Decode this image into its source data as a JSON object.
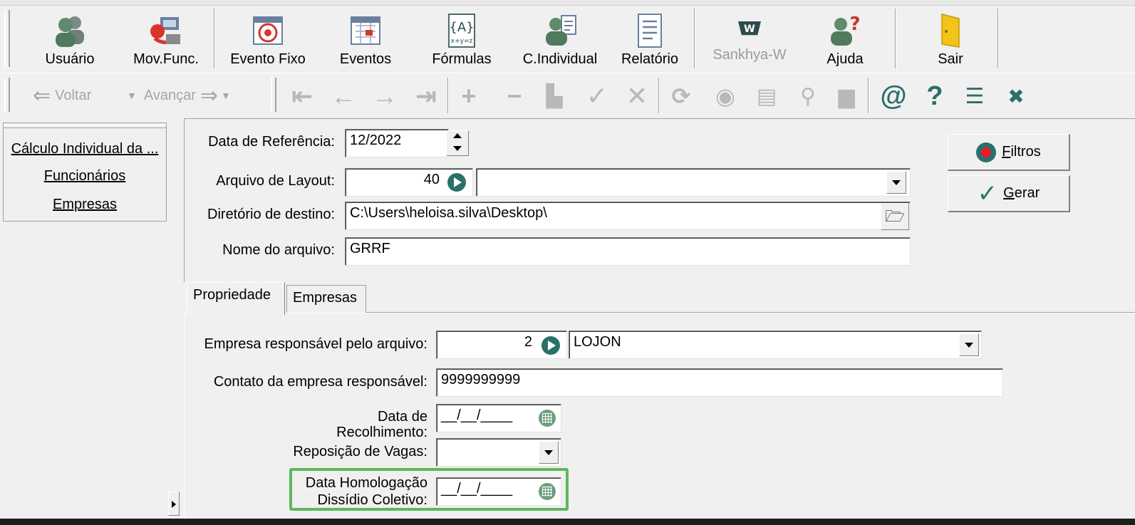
{
  "toolbar": {
    "buttons": [
      {
        "id": "usuario",
        "label": "Usuário",
        "icon": "users-icon"
      },
      {
        "id": "movfunc",
        "label": "Mov.Func.",
        "icon": "transfer-icon"
      },
      {
        "id": "eventofixo",
        "label": "Evento Fixo",
        "icon": "calendar-target-icon"
      },
      {
        "id": "eventos",
        "label": "Eventos",
        "icon": "calendar-icon"
      },
      {
        "id": "formulas",
        "label": "Fórmulas",
        "icon": "formula-icon"
      },
      {
        "id": "cindividual",
        "label": "C.Individual",
        "icon": "user-card-icon"
      },
      {
        "id": "relatorio",
        "label": "Relatório",
        "icon": "report-icon"
      },
      {
        "id": "sankhyaw",
        "label": "Sankhya-W",
        "icon": "sankhya-logo-icon"
      },
      {
        "id": "ajuda",
        "label": "Ajuda",
        "icon": "help-user-icon"
      },
      {
        "id": "sair",
        "label": "Sair",
        "icon": "exit-door-icon"
      }
    ]
  },
  "nav": {
    "voltar": "Voltar",
    "avancar": "Avançar"
  },
  "sidebar": {
    "items": [
      {
        "label": "Cálculo Individual da ..."
      },
      {
        "label": "Funcionários"
      },
      {
        "label": "Empresas"
      }
    ]
  },
  "form": {
    "data_referencia_label": "Data de Referência:",
    "data_referencia_value": "12/2022",
    "arquivo_layout_label": "Arquivo de Layout:",
    "arquivo_layout_code": "40",
    "arquivo_layout_desc": "",
    "diretorio_label": "Diretório de destino:",
    "diretorio_value": "C:\\Users\\heloisa.silva\\Desktop\\",
    "nome_arquivo_label": "Nome do arquivo:",
    "nome_arquivo_value": "GRRF"
  },
  "actions": {
    "filtros_pre": "",
    "filtros_ul": "F",
    "filtros_rest": "iltros",
    "gerar_ul": "G",
    "gerar_rest": "erar"
  },
  "tabs": [
    {
      "label": "Propriedade"
    },
    {
      "label": "Empresas"
    }
  ],
  "props": {
    "empresa_label": "Empresa responsável pelo arquivo:",
    "empresa_code": "2",
    "empresa_name": "LOJON",
    "contato_label": "Contato da empresa responsável:",
    "contato_value": "9999999999",
    "data_recolhimento_label_1": "Data de",
    "data_recolhimento_label_2": "Recolhimento:",
    "data_recolhimento_value": "__/__/____",
    "reposicao_label": "Reposição de Vagas:",
    "reposicao_value": "",
    "homologacao_label_1": "Data Homologação",
    "homologacao_label_2": "Dissídio Coletivo:",
    "homologacao_value": "__/__/____"
  }
}
